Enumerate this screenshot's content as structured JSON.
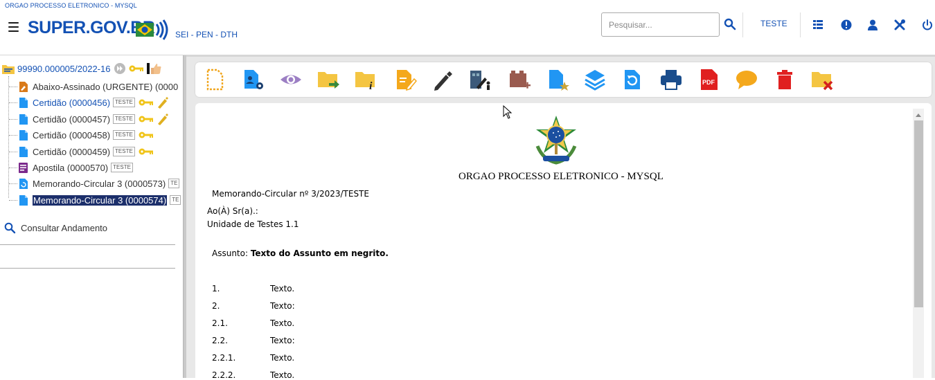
{
  "header": {
    "org_name": "ORGAO PROCESSO ELETRONICO - MYSQL",
    "logo_text": "SUPER.GOV.BR",
    "subtitle": "SEI - PEN - DTH",
    "search_placeholder": "Pesquisar...",
    "unit": "TESTE",
    "icons": [
      "grid-icon",
      "info-icon",
      "user-icon",
      "tools-icon",
      "power-icon"
    ]
  },
  "tree": {
    "process_number": "99990.000005/2022-16",
    "documents": [
      {
        "label": "Abaixo-Assinado (URGENTE) (0000",
        "badge": "",
        "icon": "signed-doc-icon"
      },
      {
        "label": "Certidão (0000456)",
        "badge": "TESTE",
        "icon": "doc-icon"
      },
      {
        "label": "Certidão (0000457)",
        "badge": "TESTE",
        "icon": "doc-icon"
      },
      {
        "label": "Certidão (0000458)",
        "badge": "TESTE",
        "icon": "doc-icon"
      },
      {
        "label": "Certidão (0000459)",
        "badge": "TESTE",
        "icon": "doc-icon"
      },
      {
        "label": "Apostila (0000570)",
        "badge": "TESTE",
        "icon": "form-doc-icon"
      },
      {
        "label": "Memorando-Circular 3 (0000573)",
        "badge": "TE",
        "icon": "refresh-doc-icon"
      },
      {
        "label": "Memorando-Circular 3 (0000574)",
        "badge": "TE",
        "icon": "doc-icon"
      }
    ],
    "consult_label": "Consultar Andamento"
  },
  "toolbar": {
    "buttons": [
      "new-doc-icon",
      "doc-settings-icon",
      "view-icon",
      "move-folder-icon",
      "folder-info-icon",
      "edit-doc-icon",
      "sign-pen-icon",
      "sign-block-icon",
      "add-block-icon",
      "favorite-doc-icon",
      "layers-icon",
      "refresh-doc-icon",
      "print-icon",
      "pdf-icon",
      "comment-icon",
      "delete-icon",
      "remove-folder-icon"
    ]
  },
  "document": {
    "org_name": "ORGAO PROCESSO ELETRONICO - MYSQL",
    "memo_id": "Memorando-Circular nº 3/2023/TESTE",
    "to_line": "Ao(À) Sr(a).:",
    "unit_line": "Unidade de Testes 1.1",
    "subject_label": "Assunto: ",
    "subject_text": "Texto do Assunto em negrito.",
    "items": [
      {
        "num": "1.",
        "text": "Texto."
      },
      {
        "num": "2.",
        "text": "Texto:"
      },
      {
        "num": "2.1.",
        "text": "Texto."
      },
      {
        "num": "2.2.",
        "text": "Texto:"
      },
      {
        "num": "2.2.1.",
        "text": "Texto."
      },
      {
        "num": "2.2.2.",
        "text": "Texto."
      }
    ]
  },
  "colors": {
    "brand_blue": "#1351b4",
    "selected_bg": "#1c2f6b",
    "key_yellow": "#f0c419",
    "doc_blue": "#2196f3"
  }
}
